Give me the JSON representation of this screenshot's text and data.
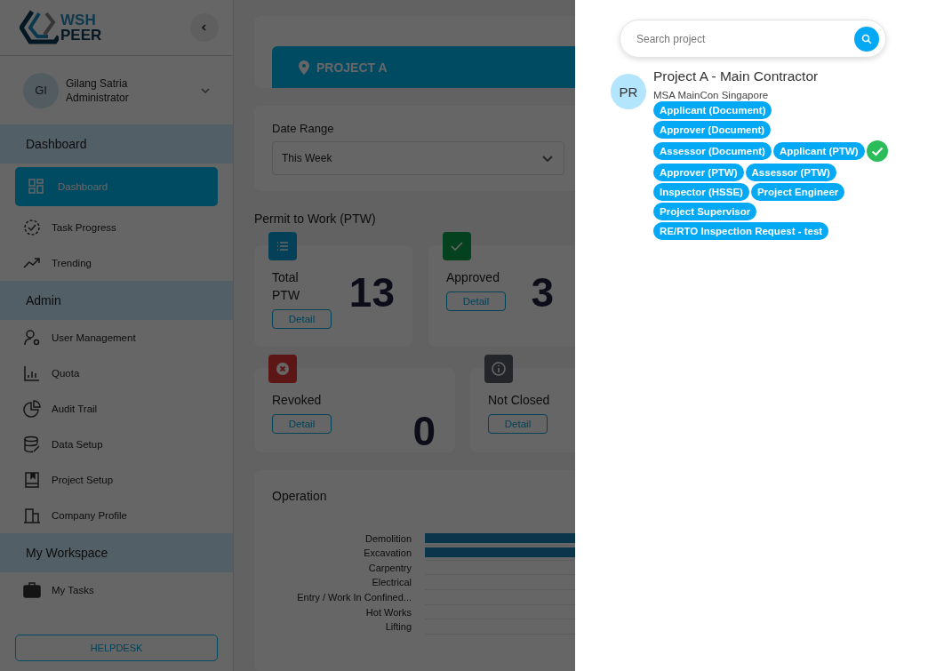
{
  "sidebar": {
    "logo": {
      "line_1": "WSH",
      "line_2": "PEER"
    },
    "user": {
      "initials": "GI",
      "name": "Gilang Satria",
      "role": "Administrator"
    },
    "sections": [
      {
        "title": "Dashboard",
        "items": [
          {
            "label": "Dashboard",
            "kind": "grid",
            "selected": true
          },
          {
            "label": "Task Progress",
            "kind": "progress",
            "selected": false
          },
          {
            "label": "Trending",
            "kind": "trend",
            "selected": false
          }
        ]
      },
      {
        "title": "Admin",
        "items": [
          {
            "label": "User Management",
            "kind": "user",
            "selected": false
          },
          {
            "label": "Quota",
            "kind": "bars",
            "selected": false
          },
          {
            "label": "Audit Trail",
            "kind": "pie",
            "selected": false
          },
          {
            "label": "Data Setup",
            "kind": "database",
            "selected": false
          },
          {
            "label": "Project Setup",
            "kind": "book",
            "selected": false
          },
          {
            "label": "Company Profile",
            "kind": "building",
            "selected": false
          }
        ]
      },
      {
        "title": "My Workspace",
        "items": [
          {
            "label": "My Tasks",
            "kind": "briefcase",
            "selected": false
          }
        ]
      }
    ],
    "helpdesk": "HELPDESK"
  },
  "main": {
    "project": "PROJECT A",
    "date_range": {
      "label": "Date Range",
      "value": "This Week"
    },
    "ptw": {
      "title": "Permit to Work (PTW)",
      "cards": [
        {
          "kind": "total",
          "label": "Total PTW",
          "value": "13",
          "button": "Detail"
        },
        {
          "kind": "approved",
          "label": "Approved",
          "value": "3",
          "button": "Detail"
        },
        {
          "kind": "revoked",
          "label": "Revoked",
          "value": "0",
          "button": "Detail"
        },
        {
          "kind": "not_closed",
          "label": "Not Closed",
          "button": "Detail"
        }
      ]
    },
    "operation": {
      "title": "Operation",
      "categories": [
        {
          "label": "Demolition",
          "bar": true
        },
        {
          "label": "Excavation",
          "bar": true
        },
        {
          "label": "Carpentry",
          "bar": false
        },
        {
          "label": "Electrical",
          "bar": false
        },
        {
          "label": "Entry / Work In Confined...",
          "bar": false
        },
        {
          "label": "Hot Works",
          "bar": false
        },
        {
          "label": "Lifting",
          "bar": false
        }
      ]
    }
  },
  "drawer": {
    "search": {
      "placeholder": "Search project"
    },
    "projects": [
      {
        "initials": "PR",
        "name": "Project A - Main Contractor",
        "company": "MSA MainCon Singapore",
        "roles": [
          {
            "label": "Applicant (Document)",
            "selected": false
          },
          {
            "label": "Approver (Document)",
            "selected": false
          },
          {
            "label": "Assessor (Document)",
            "selected": false
          },
          {
            "label": "Applicant (PTW)",
            "selected": true
          },
          {
            "label": "Approver (PTW)",
            "selected": false
          },
          {
            "label": "Assessor (PTW)",
            "selected": false
          },
          {
            "label": "Inspector (HSSE)",
            "selected": false
          },
          {
            "label": "Project Engineer",
            "selected": false
          },
          {
            "label": "Project Supervisor",
            "selected": false
          },
          {
            "label": "RE/RTO Inspection Request - test",
            "selected": false
          }
        ]
      }
    ]
  }
}
